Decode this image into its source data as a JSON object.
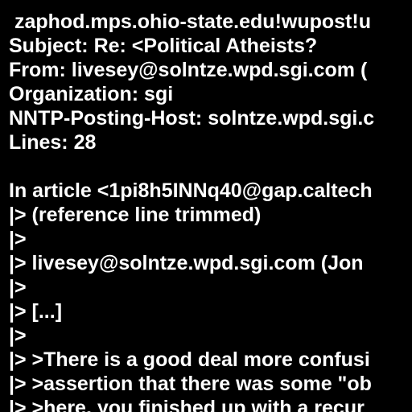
{
  "colors": {
    "background": "#000000",
    "text": "#ffffff"
  },
  "message": {
    "lines": [
      " zaphod.mps.ohio-state.edu!wupost!u",
      "Subject: Re: <Political Atheists?",
      "From: livesey@solntze.wpd.sgi.com (",
      "Organization: sgi",
      "NNTP-Posting-Host: solntze.wpd.sgi.c",
      "Lines: 28",
      "",
      "In article <1pi8h5INNq40@gap.caltech",
      "|> (reference line trimmed)",
      "|>",
      "|> livesey@solntze.wpd.sgi.com (Jon",
      "|>",
      "|> [...]",
      "|>",
      "|> >There is a good deal more confusi",
      "|> >assertion that there was some \"ob",
      "|> >here, you finished up with a recur"
    ]
  }
}
